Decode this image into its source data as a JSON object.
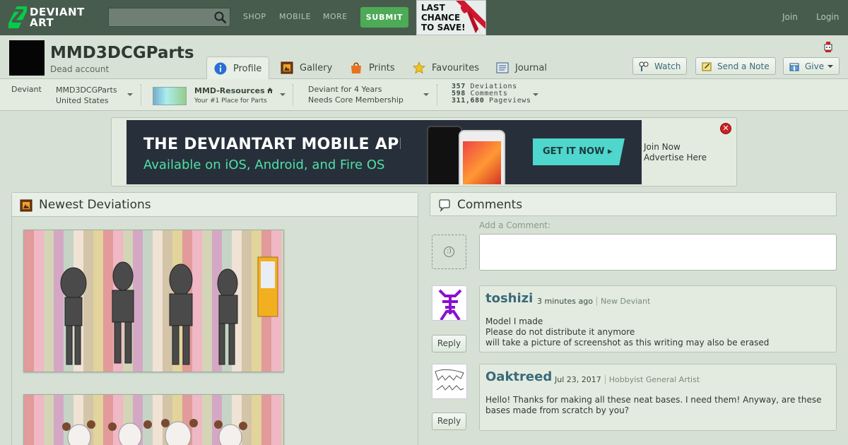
{
  "topbar": {
    "logo_line1": "DEVIANT",
    "logo_line2": "ART",
    "search_placeholder": "",
    "nav": [
      "SHOP",
      "MOBILE",
      "MORE"
    ],
    "submit_label": "SUBMIT",
    "promo_lines": [
      "LAST",
      "CHANCE",
      "TO SAVE!"
    ],
    "join_label": "Join",
    "login_label": "Login"
  },
  "profile": {
    "username": "MMD3DCGParts",
    "tagline": "Dead account",
    "tabs": [
      {
        "label": "Profile",
        "icon": "info-icon",
        "active": true
      },
      {
        "label": "Gallery",
        "icon": "gallery-icon",
        "active": false
      },
      {
        "label": "Prints",
        "icon": "prints-icon",
        "active": false
      },
      {
        "label": "Favourites",
        "icon": "star-icon",
        "active": false
      },
      {
        "label": "Journal",
        "icon": "journal-icon",
        "active": false
      }
    ],
    "buttons": {
      "watch": "Watch",
      "note": "Send a Note",
      "give": "Give"
    }
  },
  "infobar": {
    "rank": "Deviant",
    "name": "MMD3DCGParts",
    "country": "United States",
    "group_name": "MMD-Resources",
    "group_tagline": "Your #1 Place for Parts",
    "member_since": "Deviant for 4 Years",
    "membership": "Needs Core Membership",
    "stats": {
      "deviations": "357",
      "deviations_label": "Deviations",
      "comments": "598",
      "comments_label": "Comments",
      "pageviews": "311,680",
      "pageviews_label": "Pageviews"
    }
  },
  "ad": {
    "headline": "THE DEVIANTART MOBILE APP",
    "subline": "Available on iOS, Android, and Fire OS",
    "cta": "GET IT NOW ▸",
    "join_now": "Join Now",
    "advertise": "Advertise Here",
    "close_glyph": "✕"
  },
  "newest": {
    "title": "Newest Deviations"
  },
  "comments": {
    "title": "Comments",
    "add_label": "Add a Comment:",
    "reply_label": "Reply",
    "items": [
      {
        "author": "toshizi",
        "time": "3 minutes ago",
        "role": "New Deviant",
        "text": "Model I made\nPlease do not distribute it anymore\nwill take a picture of screenshot as this writing may also be erased"
      },
      {
        "author": "Oaktreed",
        "time": "Jul 23, 2017",
        "role": "Hobbyist General Artist",
        "text": "Hello! Thanks for making all these neat bases. I need them! Anyway, are these bases made from scratch by you?"
      }
    ]
  },
  "colors": {
    "topbar": "#475c4d",
    "accent_green": "#05cc47",
    "submit": "#4daa57",
    "link": "#3a6a78",
    "background": "#d6e0d4"
  }
}
